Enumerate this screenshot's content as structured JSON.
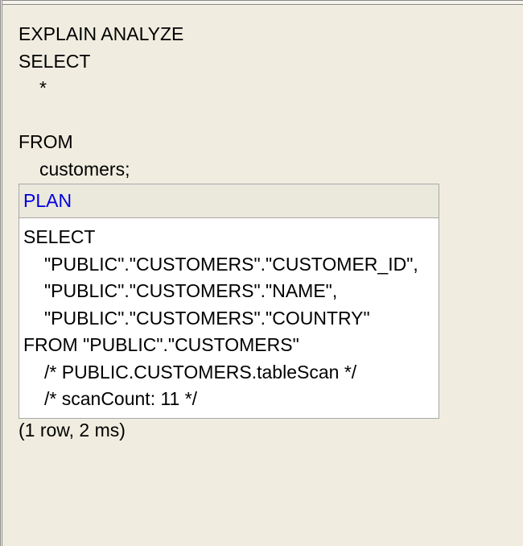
{
  "query": {
    "lines": [
      "EXPLAIN ANALYZE",
      "SELECT",
      "*",
      "",
      "FROM",
      "customers;"
    ]
  },
  "result": {
    "header": "PLAN",
    "plan_lines": [
      "SELECT",
      "\"PUBLIC\".\"CUSTOMERS\".\"CUSTOMER_ID\",",
      "\"PUBLIC\".\"CUSTOMERS\".\"NAME\",",
      "\"PUBLIC\".\"CUSTOMERS\".\"COUNTRY\"",
      "FROM \"PUBLIC\".\"CUSTOMERS\"",
      "/* PUBLIC.CUSTOMERS.tableScan */",
      "/* scanCount: 11 */"
    ]
  },
  "status": "(1 row, 2 ms)",
  "colors": {
    "background": "#f0ede0",
    "header_link": "#0000e0",
    "table_border": "#a8a8a8"
  }
}
